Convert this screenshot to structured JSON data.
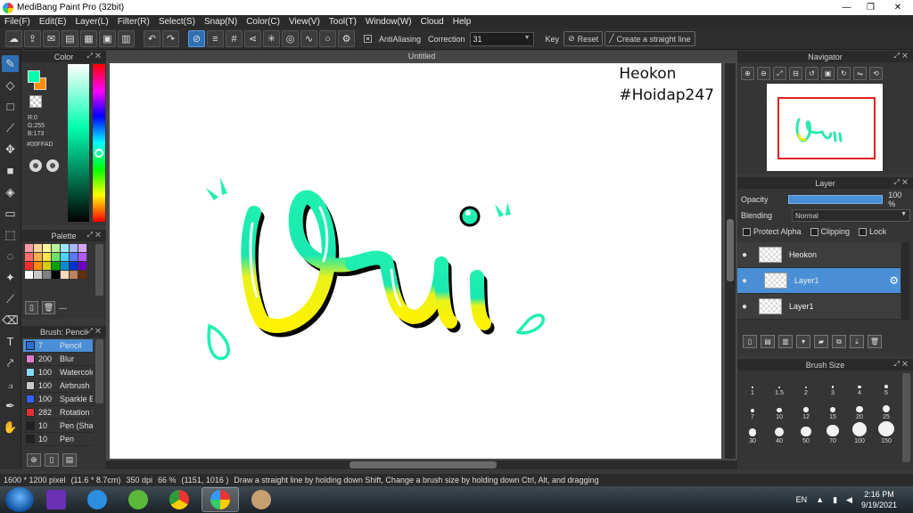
{
  "window": {
    "title": "MediBang Paint Pro (32bit)",
    "minimize": "—",
    "maximize": "❐",
    "close": "✕"
  },
  "menu": [
    "File(F)",
    "Edit(E)",
    "Layer(L)",
    "Filter(R)",
    "Select(S)",
    "Snap(N)",
    "Color(C)",
    "View(V)",
    "Tool(T)",
    "Window(W)",
    "Cloud",
    "Help"
  ],
  "toolbar": {
    "antialiasing_label": "AntiAliasing",
    "correction_label": "Correction",
    "correction_value": "31",
    "key_label": "Key",
    "reset_label": "Reset",
    "straight_line_label": "Create a straight line"
  },
  "color_panel": {
    "title": "Color",
    "r": "R:0",
    "g": "G:255",
    "b": "B:173",
    "hex": "#00FFAD",
    "main_color": "#00FFAD",
    "sub_color": "#FF8A00"
  },
  "palette_panel": {
    "title": "Palette",
    "colors": [
      "#ff9aa6",
      "#ffd39a",
      "#fff59a",
      "#b6f59a",
      "#9ae7ff",
      "#a6b6ff",
      "#d6a6ff",
      "#ff6b6b",
      "#ffb04a",
      "#ffe44a",
      "#6be06b",
      "#4ad4ff",
      "#5a78ff",
      "#b25aff",
      "#ff2a2a",
      "#ff8a00",
      "#d0d000",
      "#00a000",
      "#008ad0",
      "#0030d0",
      "#7000c0",
      "#ffffff",
      "#c8c8c8",
      "#808080",
      "#000000",
      "#ffd8c0",
      "#c08060",
      "#603010"
    ],
    "footer_value": "---"
  },
  "brush_panel": {
    "title": "Brush: Pencil",
    "brushes": [
      {
        "size": "7",
        "name": "Pencil",
        "color": "#2a6fd6"
      },
      {
        "size": "200",
        "name": "Blur",
        "color": "#e07ad0"
      },
      {
        "size": "100",
        "name": "Watercolor",
        "color": "#8ad8ff"
      },
      {
        "size": "100",
        "name": "Airbrush",
        "color": "#c8c8c8"
      },
      {
        "size": "100",
        "name": "Sparkle Brush",
        "color": "#3060ff"
      },
      {
        "size": "282",
        "name": "Rotation Symmetry",
        "color": "#e03030"
      },
      {
        "size": "10",
        "name": "Pen (Sharp)",
        "color": "#202020"
      },
      {
        "size": "10",
        "name": "Pen",
        "color": "#202020"
      }
    ]
  },
  "document": {
    "tab_title": "Untitled",
    "watermark_line1": "Heokon",
    "watermark_line2": "#Hoidap247"
  },
  "navigator": {
    "title": "Navigator"
  },
  "layer_panel": {
    "title": "Layer",
    "opacity_label": "Opacity",
    "opacity_value": "100 %",
    "opacity_fraction": 1.0,
    "blending_label": "Blending",
    "blending_value": "Normal",
    "protect_alpha": "Protect Alpha",
    "clipping": "Clipping",
    "lock": "Lock",
    "layers": [
      {
        "name": "Heokon",
        "selected": false
      },
      {
        "name": "Layer1",
        "selected": true
      },
      {
        "name": "Layer1",
        "selected": false
      }
    ]
  },
  "brush_size_panel": {
    "title": "Brush Size",
    "sizes": [
      "1",
      "1.5",
      "2",
      "3",
      "4",
      "5",
      "7",
      "10",
      "12",
      "15",
      "20",
      "25",
      "30",
      "40",
      "50",
      "70",
      "100",
      "150"
    ]
  },
  "status": {
    "pixels": "1600 * 1200 pixel",
    "physical": "(11.6 * 8.7cm)",
    "dpi": "350 dpi",
    "zoom": "66 %",
    "coords": "(1151, 1016 )",
    "hint": "Draw a straight line by holding down Shift, Change a brush size by holding down Ctrl, Alt, and dragging"
  },
  "taskbar": {
    "lang": "EN",
    "time": "2:16 PM",
    "date": "9/19/2021"
  }
}
